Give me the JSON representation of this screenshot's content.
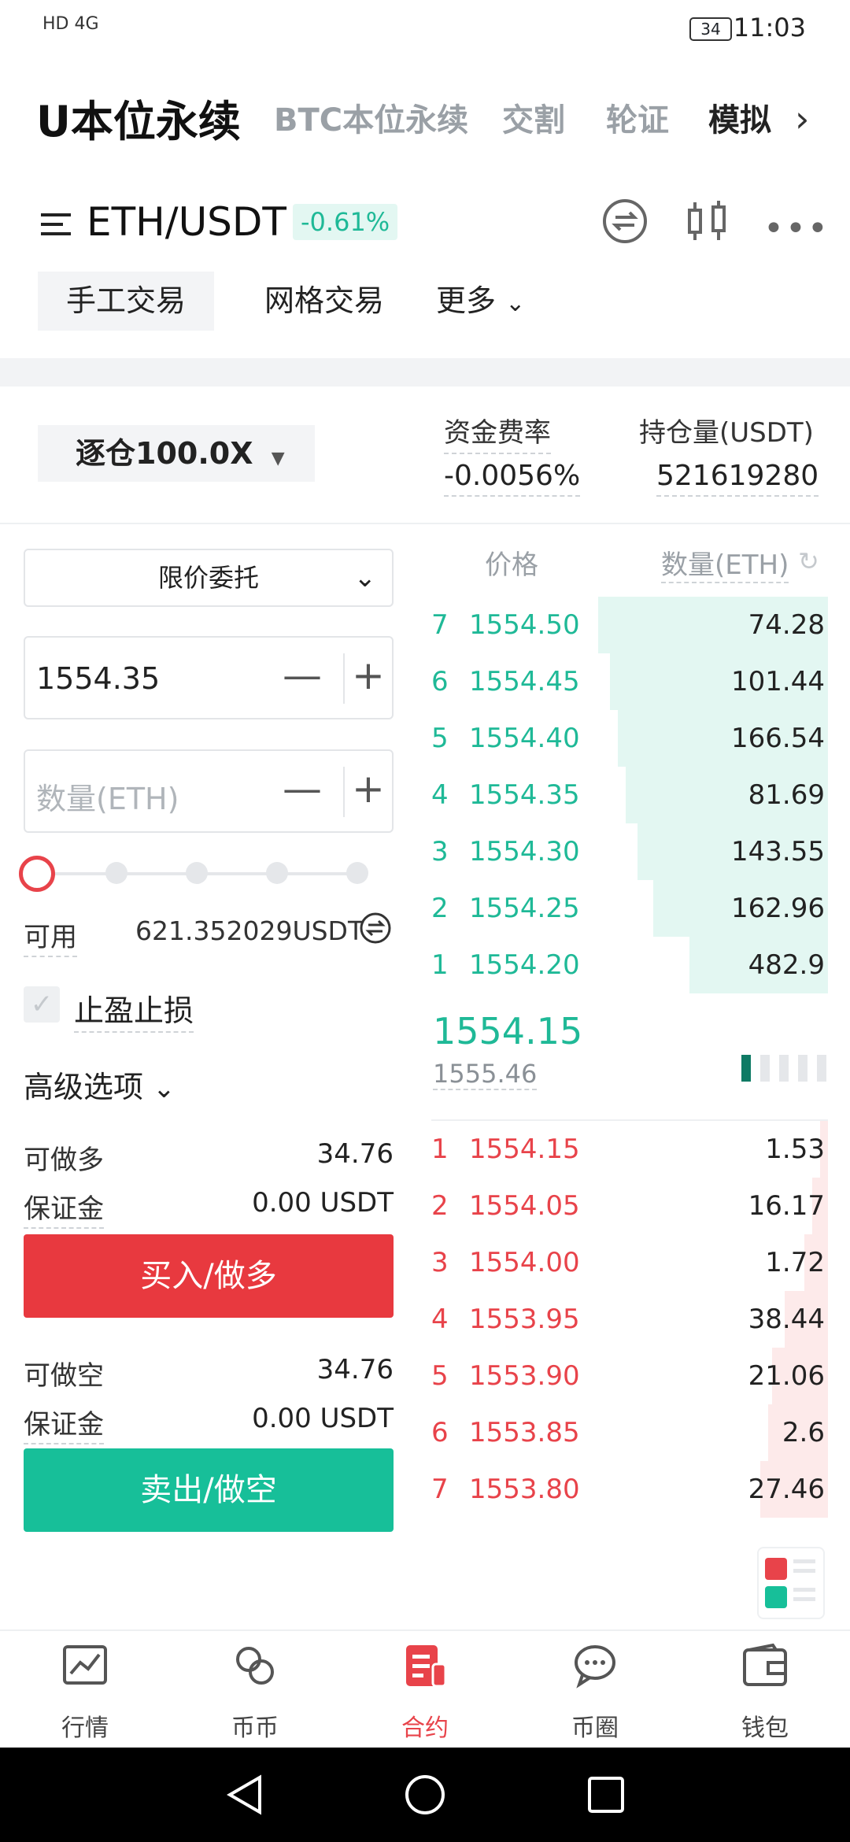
{
  "status": {
    "left": "HD 4G",
    "battery": "34",
    "time": "11:03"
  },
  "top_tabs": [
    "U本位永续",
    "BTC本位永续",
    "交割",
    "轮证",
    "模拟"
  ],
  "pair": {
    "name": "ETH/USDT",
    "change": "-0.61%"
  },
  "mode_tabs": [
    "手工交易",
    "网格交易",
    "更多"
  ],
  "leverage": "逐仓100.0X",
  "funding": {
    "label": "资金费率",
    "value": "-0.0056%"
  },
  "open_interest": {
    "label": "持仓量(USDT)",
    "value": "521619280"
  },
  "order_type": "限价委托",
  "price_input": "1554.35",
  "qty_placeholder": "数量(ETH)",
  "slider_level": 0,
  "available": {
    "label": "可用",
    "value": "621.352029USDT"
  },
  "tp_sl": "止盈止损",
  "advanced": "高级选项",
  "long": {
    "label": "可做多",
    "value": "34.76",
    "margin_label": "保证金",
    "margin_value": "0.00 USDT",
    "button": "买入/做多"
  },
  "short": {
    "label": "可做空",
    "value": "34.76",
    "margin_label": "保证金",
    "margin_value": "0.00 USDT",
    "button": "卖出/做空"
  },
  "orderbook": {
    "price_header": "价格",
    "qty_header": "数量(ETH)",
    "asks": [
      {
        "idx": "7",
        "price": "1554.50",
        "qty": "74.28",
        "depth": 0.58
      },
      {
        "idx": "6",
        "price": "1554.45",
        "qty": "101.44",
        "depth": 0.55
      },
      {
        "idx": "5",
        "price": "1554.40",
        "qty": "166.54",
        "depth": 0.53
      },
      {
        "idx": "4",
        "price": "1554.35",
        "qty": "81.69",
        "depth": 0.51
      },
      {
        "idx": "3",
        "price": "1554.30",
        "qty": "143.55",
        "depth": 0.48
      },
      {
        "idx": "2",
        "price": "1554.25",
        "qty": "162.96",
        "depth": 0.44
      },
      {
        "idx": "1",
        "price": "1554.20",
        "qty": "482.9",
        "depth": 0.35
      }
    ],
    "last_price": "1554.15",
    "mark_price": "1555.46",
    "bids": [
      {
        "idx": "1",
        "price": "1554.15",
        "qty": "1.53",
        "depth": 0.02
      },
      {
        "idx": "2",
        "price": "1554.05",
        "qty": "16.17",
        "depth": 0.04
      },
      {
        "idx": "3",
        "price": "1554.00",
        "qty": "1.72",
        "depth": 0.06
      },
      {
        "idx": "4",
        "price": "1553.95",
        "qty": "38.44",
        "depth": 0.11
      },
      {
        "idx": "5",
        "price": "1553.90",
        "qty": "21.06",
        "depth": 0.14
      },
      {
        "idx": "6",
        "price": "1553.85",
        "qty": "2.6",
        "depth": 0.15
      },
      {
        "idx": "7",
        "price": "1553.80",
        "qty": "27.46",
        "depth": 0.17
      }
    ]
  },
  "bottom_nav": [
    "行情",
    "币币",
    "合约",
    "币圈",
    "钱包"
  ],
  "colors": {
    "green": "#1fb997",
    "red": "#e8434a"
  }
}
